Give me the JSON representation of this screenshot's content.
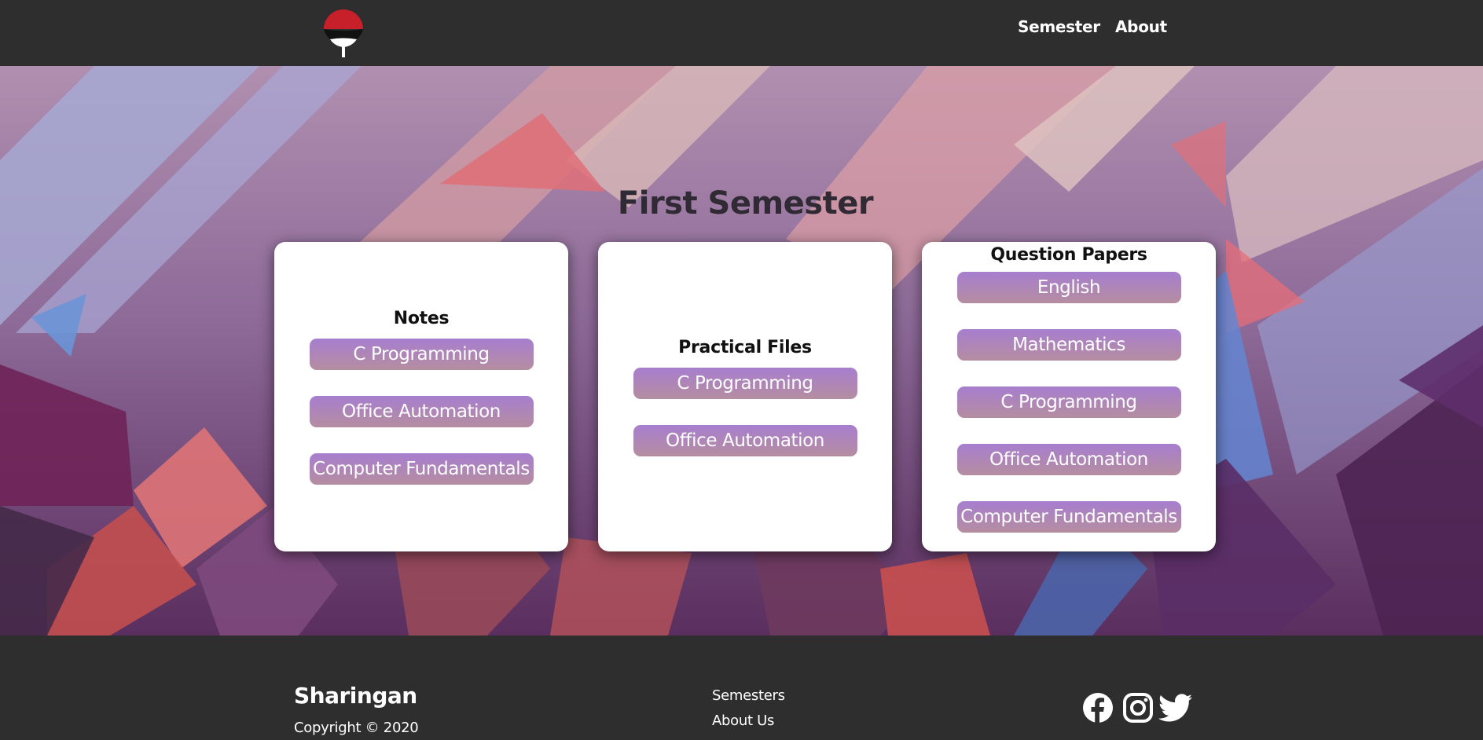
{
  "nav": {
    "logo_icon": "uchiha-fan-logo",
    "links": [
      "Semester",
      "About"
    ]
  },
  "hero": {
    "title": "First Semester"
  },
  "cards": {
    "notes": {
      "title": "Notes",
      "items": [
        "C Programming",
        "Office Automation",
        "Computer Fundamentals"
      ]
    },
    "practical": {
      "title": "Practical Files",
      "items": [
        "C Programming",
        "Office Automation"
      ]
    },
    "question_papers": {
      "title": "Question Papers",
      "items": [
        "English",
        "Mathematics",
        "C Programming",
        "Office Automation",
        "Computer Fundamentals"
      ]
    }
  },
  "footer": {
    "brand": "Sharingan",
    "copyright": "Copyright © 2020",
    "links": [
      "Semesters",
      "About Us"
    ],
    "social_icons": [
      "facebook-icon",
      "instagram-icon",
      "twitter-icon"
    ]
  },
  "colors": {
    "nav_bg": "#2e2e2e",
    "button_gradient_top": "#a77ecf",
    "button_gradient_bottom": "#b58da0",
    "title_text": "#2f2a33"
  }
}
